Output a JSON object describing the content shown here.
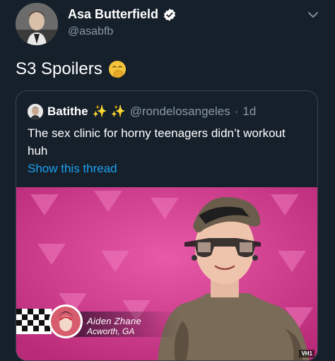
{
  "author": {
    "display_name": "Asa Butterfield",
    "handle": "@asabfb",
    "avatar_icon": "profile-photo"
  },
  "tweet": {
    "text": "S3 Spoilers",
    "emoji_icon": "face-with-hand-over-mouth-emoji"
  },
  "quoted_tweet": {
    "display_name": "Batithe",
    "name_emoji": "✨ ✨",
    "handle": "@rondelosangeles",
    "separator": "·",
    "time": "1d",
    "text": "The sex clinic for horny teenagers didn’t workout huh",
    "show_thread_label": "Show this thread",
    "media": {
      "caption_name": "Aiden Zhane",
      "caption_location": "Acworth, GA",
      "network_bug": "VH1"
    }
  },
  "colors": {
    "background": "#15202b",
    "secondary_text": "#8899a6",
    "link": "#1da1f2",
    "border": "#38444d",
    "verified": "#ffffff",
    "media_bg": "#d0388c"
  }
}
